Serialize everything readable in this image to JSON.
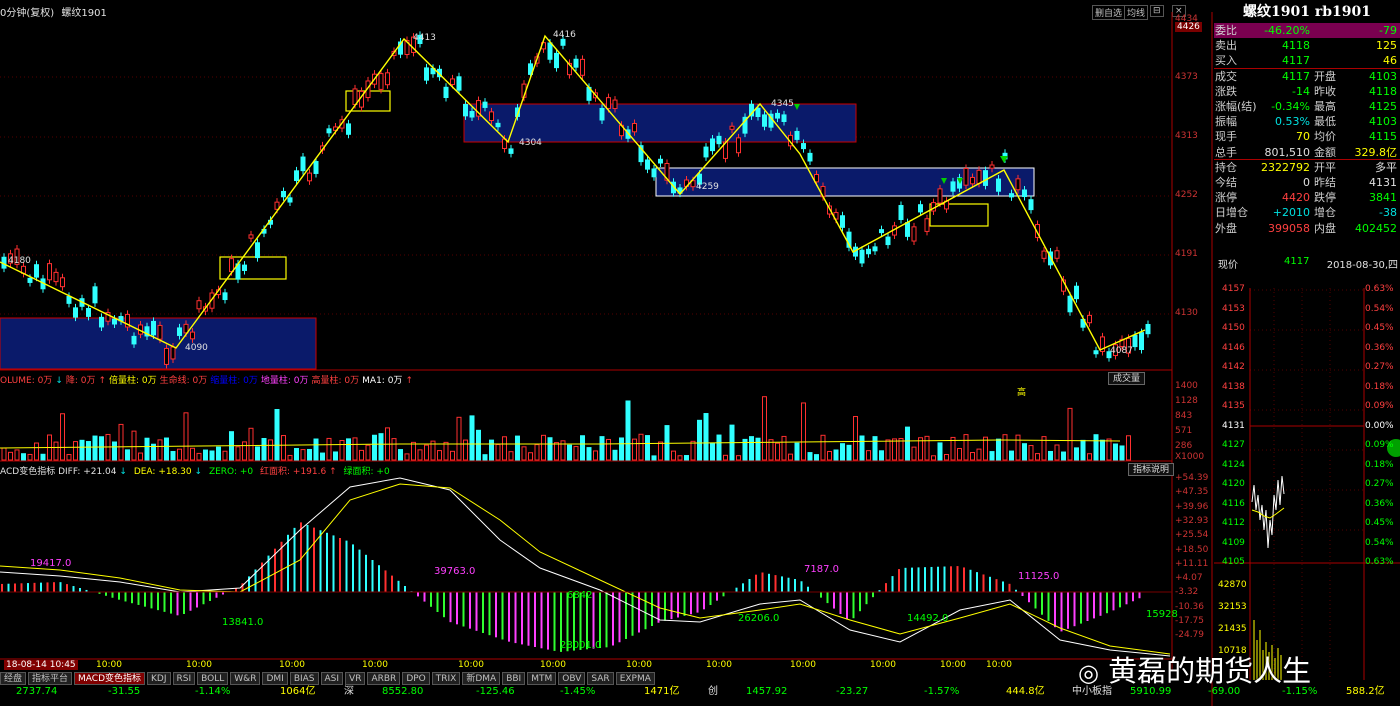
{
  "header": {
    "period": "0分钟(复权)",
    "symbol": "螺纹1901",
    "btn_left": "删自选",
    "btn_mid": "均线",
    "btn_right": "⊟",
    "btn_x": "×"
  },
  "main_chart": {
    "scale_labels": [
      "4434",
      "4426",
      "4373",
      "4313",
      "4252",
      "4191",
      "4130"
    ],
    "price_labels": [
      "4413",
      "4416",
      "4180",
      "4090",
      "4304",
      "4345",
      "4259",
      "4087"
    ],
    "extremes_desc": "zigzag trend with consolidation boxes"
  },
  "volume_panel": {
    "legend_parts": [
      {
        "text": "OLUME: 0万",
        "color": "#ff4040"
      },
      {
        "text": "↓",
        "color": "#00e0e0"
      },
      {
        "text": "降: 0万",
        "color": "#ff4040"
      },
      {
        "text": "↑",
        "color": "#ff4040"
      },
      {
        "text": "倍量柱: 0万",
        "color": "#ffff00"
      },
      {
        "text": "生命线: 0万",
        "color": "#ff4040"
      },
      {
        "text": "缩量柱: 0万",
        "color": "#0000ff"
      },
      {
        "text": "地量柱: 0万",
        "color": "#ff40ff"
      },
      {
        "text": "高量柱: 0万",
        "color": "#ff4040"
      },
      {
        "text": "MA1: 0万",
        "color": "#ffffff"
      },
      {
        "text": "↑",
        "color": "#ff4040"
      }
    ],
    "button": "成交量",
    "scale_labels": [
      "1400",
      "1128",
      "843",
      "571",
      "286",
      "X1000"
    ],
    "high_marker": "高"
  },
  "macd_panel": {
    "legend": "ACD变色指标  DIFF: +21.04",
    "legend_dea": "DEA: +18.30",
    "legend_zero": "ZERO: +0",
    "legend_red": "红面积: +191.6",
    "legend_green": "绿面积: +0",
    "button": "指标说明",
    "scale_labels": [
      "+54.39",
      "+47.35",
      "+39.96",
      "+32.93",
      "+25.54",
      "+18.50",
      "+11.11",
      "+4.07",
      "-3.32",
      "-10.36",
      "-17.75",
      "-24.79"
    ],
    "area_labels": [
      {
        "text": "19417.0",
        "color": "#ff40ff"
      },
      {
        "text": "13841.0",
        "color": "#00ff00"
      },
      {
        "text": "39763.0",
        "color": "#ff40ff"
      },
      {
        "text": "28001.0",
        "color": "#00ff00"
      },
      {
        "text": "7187.0",
        "color": "#ff40ff"
      },
      {
        "text": "26206.0",
        "color": "#00ff00"
      },
      {
        "text": "14492.0",
        "color": "#00ff00"
      },
      {
        "text": "11125.0",
        "color": "#ff40ff"
      },
      {
        "text": "15928",
        "color": "#00ff00"
      },
      {
        "text": "6842",
        "color": "#00ff00"
      }
    ]
  },
  "time_axis": {
    "start": "18-08-14 10:45",
    "labels": [
      "10:00",
      "10:00",
      "10:00",
      "10:00",
      "10:00",
      "10:00",
      "10:00",
      "10:00",
      "10:00",
      "10:00",
      "10:00",
      "10:00",
      "10:00",
      "10:00"
    ]
  },
  "tabs": [
    "经盘",
    "指标平台",
    "MACD变色指标",
    "KDJ",
    "RSI",
    "BOLL",
    "W&R",
    "DMI",
    "BIAS",
    "ASI",
    "VR",
    "ARBR",
    "DPO",
    "TRIX",
    "新DMA",
    "BBI",
    "MTM",
    "OBV",
    "SAR",
    "EXPMA"
  ],
  "index_bar": {
    "a_value": "2737.74",
    "a_change": "-31.55",
    "a_pct": "-1.14%",
    "a_amount": "1064亿",
    "b_name": "深",
    "b_value": "8552.80",
    "b_change": "-125.46",
    "b_pct": "-1.45%",
    "b_amount": "1471亿",
    "c_name": "创",
    "c_value": "1457.92",
    "c_change": "-23.27",
    "c_pct": "-1.57%",
    "c_amount": "444.8亿",
    "d_name": "中小板指",
    "d_value": "5910.99",
    "d_change": "-69.00",
    "d_pct": "-1.15%",
    "d_amount": "588.2亿"
  },
  "quote": {
    "title": "螺纹1901 rb1901",
    "rows": [
      {
        "l": "委比",
        "v1": "-46.20%",
        "c1": "#00ff00",
        "l2": "",
        "v2": "-79",
        "c2": "#00ff00"
      },
      {
        "l": "卖出",
        "v1": "4118",
        "c1": "#00ff00",
        "l2": "",
        "v2": "125",
        "c2": "#ffff00"
      },
      {
        "l": "买入",
        "v1": "4117",
        "c1": "#00ff00",
        "l2": "",
        "v2": "46",
        "c2": "#ffff00"
      },
      {
        "l": "成交",
        "v1": "4117",
        "c1": "#00ff00",
        "l2": "开盘",
        "v2": "4103",
        "c2": "#00ff00"
      },
      {
        "l": "涨跌",
        "v1": "-14",
        "c1": "#00ff00",
        "l2": "昨收",
        "v2": "4118",
        "c2": "#00ff00"
      },
      {
        "l": "涨幅(结)",
        "v1": "-0.34%",
        "c1": "#00ff00",
        "l2": "最高",
        "v2": "4125",
        "c2": "#00ff00"
      },
      {
        "l": "振幅",
        "v1": "0.53%",
        "c1": "#00e0e0",
        "l2": "最低",
        "v2": "4103",
        "c2": "#00ff00"
      },
      {
        "l": "现手",
        "v1": "70",
        "c1": "#ffff00",
        "l2": "均价",
        "v2": "4115",
        "c2": "#00ff00"
      },
      {
        "l": "总手",
        "v1": "801,510",
        "c1": "#e0e0e0",
        "l2": "金额",
        "v2": "329.8亿",
        "c2": "#ffff00"
      },
      {
        "l": "持仓",
        "v1": "2322792",
        "c1": "#ffff00",
        "l2": "开平",
        "v2": "多平",
        "c2": "#e0e0e0"
      },
      {
        "l": "今结",
        "v1": "0",
        "c1": "#e0e0e0",
        "l2": "昨结",
        "v2": "4131",
        "c2": "#e0e0e0"
      },
      {
        "l": "涨停",
        "v1": "4420",
        "c1": "#ff4040",
        "l2": "跌停",
        "v2": "3841",
        "c2": "#00ff00"
      },
      {
        "l": "日增仓",
        "v1": "+2010",
        "c1": "#00e0e0",
        "l2": "增仓",
        "v2": "-38",
        "c2": "#00e0e0"
      },
      {
        "l": "外盘",
        "v1": "399058",
        "c1": "#ff4040",
        "l2": "内盘",
        "v2": "402452",
        "c2": "#00ff00"
      }
    ],
    "cur_label": "现价",
    "cur_value": "4117",
    "date": "2018-08-30,四",
    "mini_left": [
      "4157",
      "4153",
      "4150",
      "4146",
      "4142",
      "4138",
      "4135",
      "4131",
      "4127",
      "4124",
      "4120",
      "4116",
      "4112",
      "4109",
      "4105"
    ],
    "mini_right": [
      "0.63%",
      "0.54%",
      "0.45%",
      "0.36%",
      "0.27%",
      "0.18%",
      "0.09%",
      "0.00%",
      "0.09%",
      "0.18%",
      "0.27%",
      "0.36%",
      "0.45%",
      "0.54%",
      "0.63%"
    ],
    "mini_vol": [
      "42870",
      "32153",
      "21435",
      "10718"
    ]
  },
  "watermark": "黄磊的期货人生"
}
